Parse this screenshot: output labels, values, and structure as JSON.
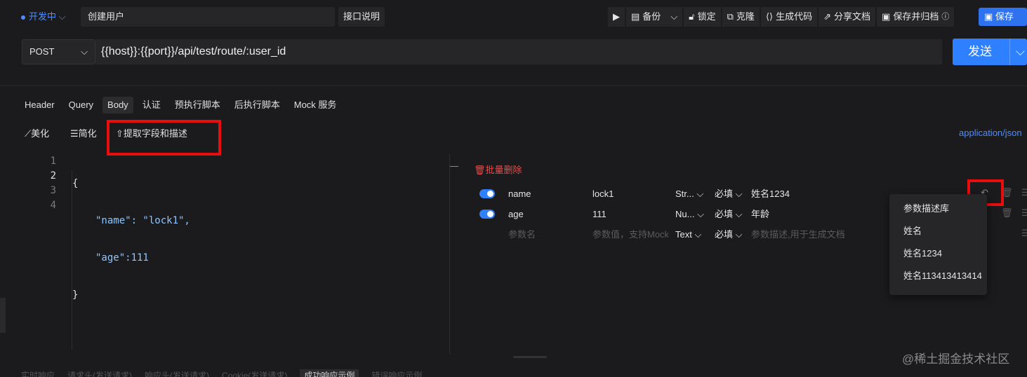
{
  "top": {
    "env": "开发中",
    "title": "创建用户",
    "doc_button": "接口说明",
    "toolbar": {
      "run": "▶",
      "backup": "备份",
      "lock": "锁定",
      "clone": "克隆",
      "gen_code": "生成代码",
      "share": "分享文档",
      "save_archive": "保存并归档",
      "save": "保存"
    }
  },
  "request": {
    "method": "POST",
    "url": "{{host}}:{{port}}/api/test/route/:user_id",
    "send": "发送"
  },
  "tabs": [
    "Header",
    "Query",
    "Body",
    "认证",
    "预执行脚本",
    "后执行脚本",
    "Mock 服务"
  ],
  "active_tab": "Body",
  "body_tools": {
    "beautify": "美化",
    "simplify": "简化",
    "extract": "提取字段和描述",
    "content_type": "application/json"
  },
  "editor": {
    "line_numbers": [
      "1",
      "2",
      "3",
      "4"
    ],
    "lines": [
      "{",
      "\"name\": \"lock1\",",
      "\"age\":111",
      "}"
    ]
  },
  "params": {
    "bulk_delete": "批量删除",
    "rows": [
      {
        "name": "name",
        "value": "lock1",
        "type": "Str...",
        "required": "必填",
        "desc": "姓名1234",
        "enabled": true
      },
      {
        "name": "age",
        "value": "111",
        "type": "Nu...",
        "required": "必填",
        "desc": "年龄",
        "enabled": true
      }
    ],
    "new_row": {
      "name_placeholder": "参数名",
      "value_placeholder": "参数值，支持Mock",
      "type": "Text",
      "required": "必填",
      "desc_placeholder": "参数描述,用于生成文档"
    }
  },
  "dropdown": {
    "items": [
      "参数描述库",
      "姓名",
      "姓名1234",
      "姓名113413413414"
    ]
  },
  "bottom_tabs": [
    "实时响应",
    "请求头(发送请求)",
    "响应头(发送请求)",
    "Cookie(发送请求)",
    "成功响应示例",
    "错误响应示例"
  ],
  "watermark": "@稀土掘金技术社区"
}
